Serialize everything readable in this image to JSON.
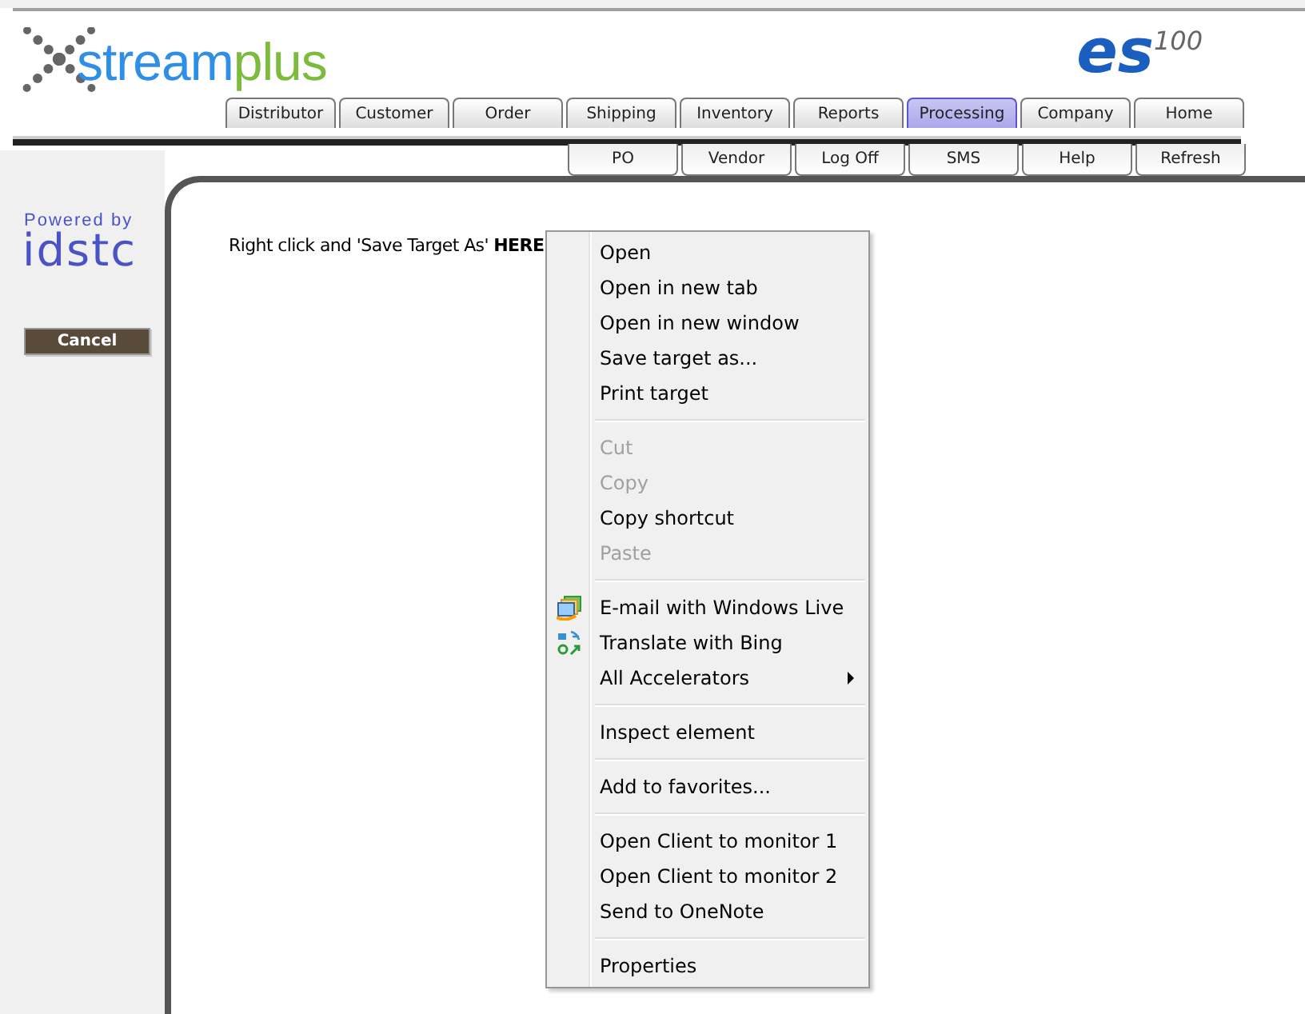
{
  "logo": {
    "first": "stream",
    "second": "plus"
  },
  "product_logo": "es$^{100}$",
  "main_tabs": [
    {
      "label": "Distributor",
      "selected": false
    },
    {
      "label": "Customer",
      "selected": false
    },
    {
      "label": "Order",
      "selected": false
    },
    {
      "label": "Shipping",
      "selected": false
    },
    {
      "label": "Inventory",
      "selected": false
    },
    {
      "label": "Reports",
      "selected": false
    },
    {
      "label": "Processing",
      "selected": true
    },
    {
      "label": "Company",
      "selected": false
    },
    {
      "label": "Home",
      "selected": false
    }
  ],
  "sub_buttons": [
    "PO",
    "Vendor",
    "Log Off",
    "SMS",
    "Help",
    "Refresh"
  ],
  "sidebar": {
    "powered_by": "Powered by",
    "brand": "idstc",
    "cancel_button": "Cancel"
  },
  "content": {
    "instruction": "Right click and 'Save Target As' **HERE**"
  },
  "context_menu": {
    "groups": [
      [
        {
          "label": "Open",
          "disabled": false,
          "kind": "plain"
        },
        {
          "label": "Open in new tab",
          "disabled": false,
          "kind": "plain"
        },
        {
          "label": "Open in new window",
          "disabled": false,
          "kind": "plain"
        },
        {
          "label": "Save target as...",
          "disabled": false,
          "kind": "plain"
        },
        {
          "label": "Print target",
          "disabled": false,
          "kind": "plain"
        }
      ],
      [
        {
          "label": "Cut",
          "disabled": true,
          "kind": "plain"
        },
        {
          "label": "Copy",
          "disabled": true,
          "kind": "plain"
        },
        {
          "label": "Copy shortcut",
          "disabled": false,
          "kind": "plain"
        },
        {
          "label": "Paste",
          "disabled": true,
          "kind": "plain"
        }
      ],
      [
        {
          "label": "E-mail with Windows Live",
          "disabled": false,
          "kind": "mail"
        },
        {
          "label": "Translate with Bing",
          "disabled": false,
          "kind": "translate"
        },
        {
          "label": "All Accelerators",
          "disabled": false,
          "kind": "submenu"
        }
      ],
      [
        {
          "label": "Inspect element",
          "disabled": false,
          "kind": "plain"
        }
      ],
      [
        {
          "label": "Add to favorites...",
          "disabled": false,
          "kind": "plain"
        }
      ],
      [
        {
          "label": "Open Client to monitor 1",
          "disabled": false,
          "kind": "plain"
        },
        {
          "label": "Open Client to monitor 2",
          "disabled": false,
          "kind": "plain"
        },
        {
          "label": "Send to OneNote",
          "disabled": false,
          "kind": "plain"
        }
      ],
      [
        {
          "label": "Properties",
          "disabled": false,
          "kind": "plain"
        }
      ]
    ]
  }
}
